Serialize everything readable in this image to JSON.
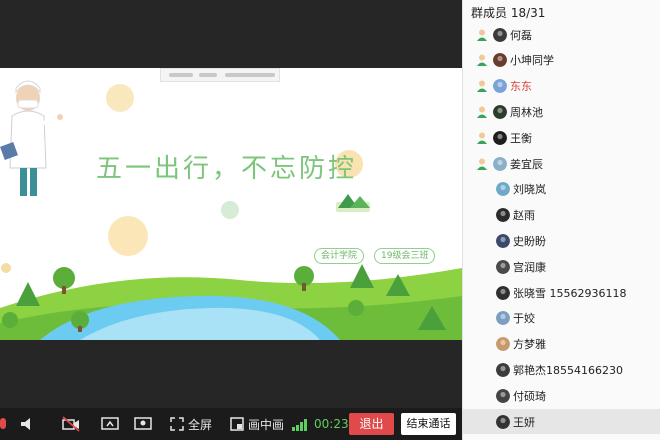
{
  "slide": {
    "title": "五一出行，不忘防控",
    "tags": [
      "会计学院",
      "19级会三班"
    ]
  },
  "controls": {
    "fullscreen_label": "全屏",
    "pip_label": "画中画",
    "timer": "00:23",
    "exit_label": "退出",
    "end_call_label": "结束通话"
  },
  "panel": {
    "header": "群成员 18/31",
    "members": [
      {
        "name": "何磊",
        "person_icon": true,
        "avatar_color": "#3a3a3a"
      },
      {
        "name": "小坤同学",
        "person_icon": true,
        "avatar_color": "#6b3b2b"
      },
      {
        "name": "东东",
        "person_icon": true,
        "avatar_color": "#7aa3d8",
        "highlight": true
      },
      {
        "name": "周林池",
        "person_icon": true,
        "avatar_color": "#2d3d2d"
      },
      {
        "name": "王衡",
        "person_icon": true,
        "avatar_color": "#1e1e1e"
      },
      {
        "name": "姜宜辰",
        "person_icon": true,
        "avatar_color": "#8ab0c8"
      },
      {
        "name": "刘晓岚",
        "person_icon": false,
        "avatar_color": "#6fa9c9"
      },
      {
        "name": "赵雨",
        "person_icon": false,
        "avatar_color": "#2b2b2b"
      },
      {
        "name": "史盼盼",
        "person_icon": false,
        "avatar_color": "#3a4a6a"
      },
      {
        "name": "宫润康",
        "person_icon": false,
        "avatar_color": "#4a4a4a"
      },
      {
        "name": "张晓雪 15562936118",
        "person_icon": false,
        "avatar_color": "#2f2f2f"
      },
      {
        "name": "于姣",
        "person_icon": false,
        "avatar_color": "#7b9fc0"
      },
      {
        "name": "方梦雅",
        "person_icon": false,
        "avatar_color": "#c89a6b"
      },
      {
        "name": "郭艳杰18554166230",
        "person_icon": false,
        "avatar_color": "#3b3b3b"
      },
      {
        "name": "付硕琦",
        "person_icon": false,
        "avatar_color": "#444444"
      },
      {
        "name": "王妍",
        "person_icon": false,
        "avatar_color": "#333333",
        "selected": true
      }
    ]
  },
  "colors": {
    "accent_green": "#7cc57a",
    "exit_red": "#e04a4a",
    "highlight_name": "#d9443a"
  }
}
